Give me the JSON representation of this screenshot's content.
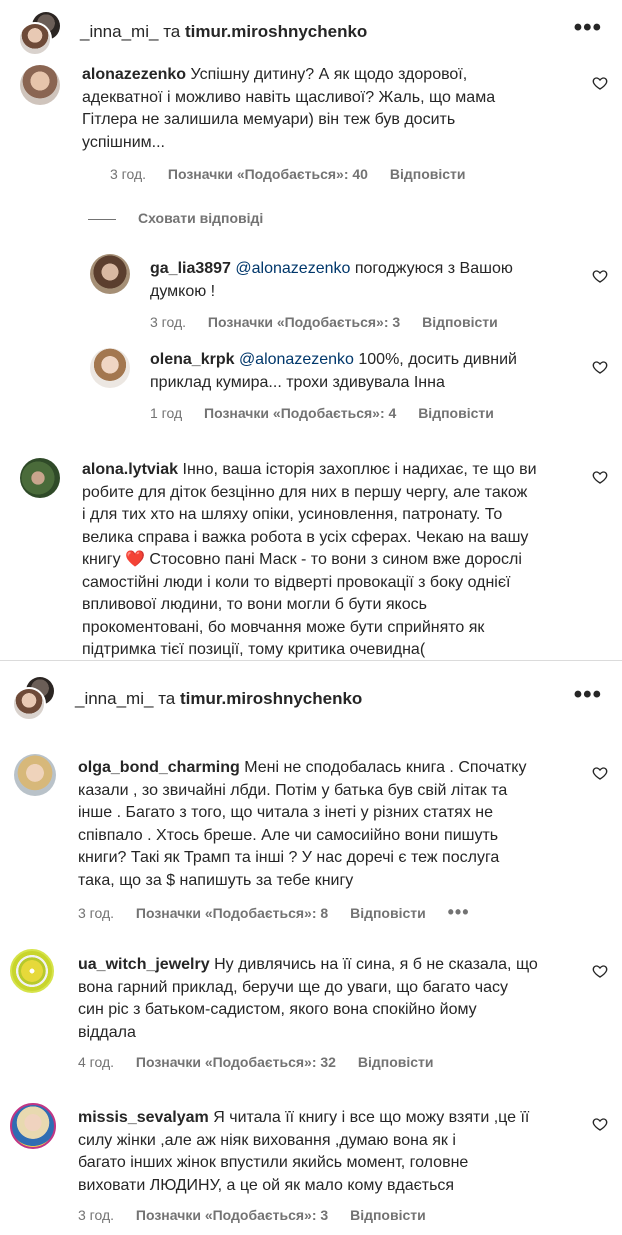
{
  "thread1": {
    "header": {
      "user1": "_inna_mi_",
      "conj": "та",
      "user2": "timur.miroshnychenko",
      "more_icon": "ellipsis-icon"
    },
    "comments": [
      {
        "user": "alonazezenko",
        "lines": [
          "Успішну дитину? А як щодо здорової,",
          "адекватної і можливо навіть щасливої? Жаль, що мама",
          "Гітлера не залишила мемуари) він теж був досить",
          "успішним..."
        ],
        "time": "3 год.",
        "likes": "Позначки «Подобається»: 40",
        "reply": "Відповісти"
      },
      {
        "user": "ga_lia3897",
        "mention": "@alonazezenko",
        "lines": [
          "погоджуюся з Вашою",
          "думкою !"
        ],
        "time": "3 год.",
        "likes": "Позначки «Подобається»: 3",
        "reply": "Відповісти"
      },
      {
        "user": "olena_krpk",
        "mention": "@alonazezenko",
        "lines": [
          "100%, досить дивний",
          "приклад кумира... трохи здивувала Інна"
        ],
        "time": "1 год",
        "likes": "Позначки «Подобається»: 4",
        "reply": "Відповісти"
      },
      {
        "user": "alona.lytviak",
        "lines": [
          "Інно, ваша історія захоплює і надихає, те що ви",
          "робите для діток безцінно для них в першу чергу, але також",
          "і для тих хто на шляху опіки, усиновлення, патронату. То",
          "велика справа і важка робота в усіх сферах. Чекаю на вашу",
          "книгу ❤️ Стосовно пані Маск - то вони з сином вже дорослі",
          "самостійні люди і коли то відверті провокації з боку однієї",
          "впливової людини, то вони могли б бути якось",
          "прокоментовані, бо мовчання може бути сприйнято як",
          "підтримка тієї позиції, тому критика очевидна("
        ]
      }
    ],
    "hide_replies": "Сховати відповіді"
  },
  "thread2": {
    "header": {
      "user1": "_inna_mi_",
      "conj": "та",
      "user2": "timur.miroshnychenko",
      "more_icon": "ellipsis-icon"
    },
    "comments": [
      {
        "user": "olga_bond_charming",
        "lines": [
          "Мені не сподобалась книга . Спочатку",
          "казали , зо звичайні лбди. Потім у батька був свій літак та",
          "інше . Багато з того, що читала з інеті у різних статях не",
          "співпало . Хтось бреше. Але чи самосиійно вони пишуть",
          "книги? Такі як Трамп та інші ? У нас доречі є теж послуга",
          "така, що за $ напишуть за тебе книгу"
        ],
        "time": "3 год.",
        "likes": "Позначки «Подобається»: 8",
        "reply": "Відповісти",
        "more": "•••"
      },
      {
        "user": "ua_witch_jewelry",
        "lines": [
          "Ну дивлячись на її сина, я б не сказала, що",
          "вона гарний приклад, беручи ще до уваги, що багато часу",
          "син ріс з батьком-садистом, якого вона спокійно йому",
          "віддала"
        ],
        "time": "4 год.",
        "likes": "Позначки «Подобається»: 32",
        "reply": "Відповісти"
      },
      {
        "user": "missis_sevalyam",
        "lines": [
          "Я читала її книгу і все що можу взяти ,це її",
          "силу жінки ,але аж ніяк виховання ,думаю вона як і",
          "багато інших жінок впустили якийсь момент, головне",
          "виховати ЛЮДИНУ, а це ой як мало кому вдається"
        ],
        "time": "3 год.",
        "likes": "Позначки «Подобається»: 3",
        "reply": "Відповісти"
      }
    ]
  },
  "icons": {
    "like": "heart-outline-icon"
  },
  "colors": {
    "text": "#262626",
    "secondary": "#737373",
    "mention": "#00376b",
    "divider": "#dbdbdb"
  }
}
